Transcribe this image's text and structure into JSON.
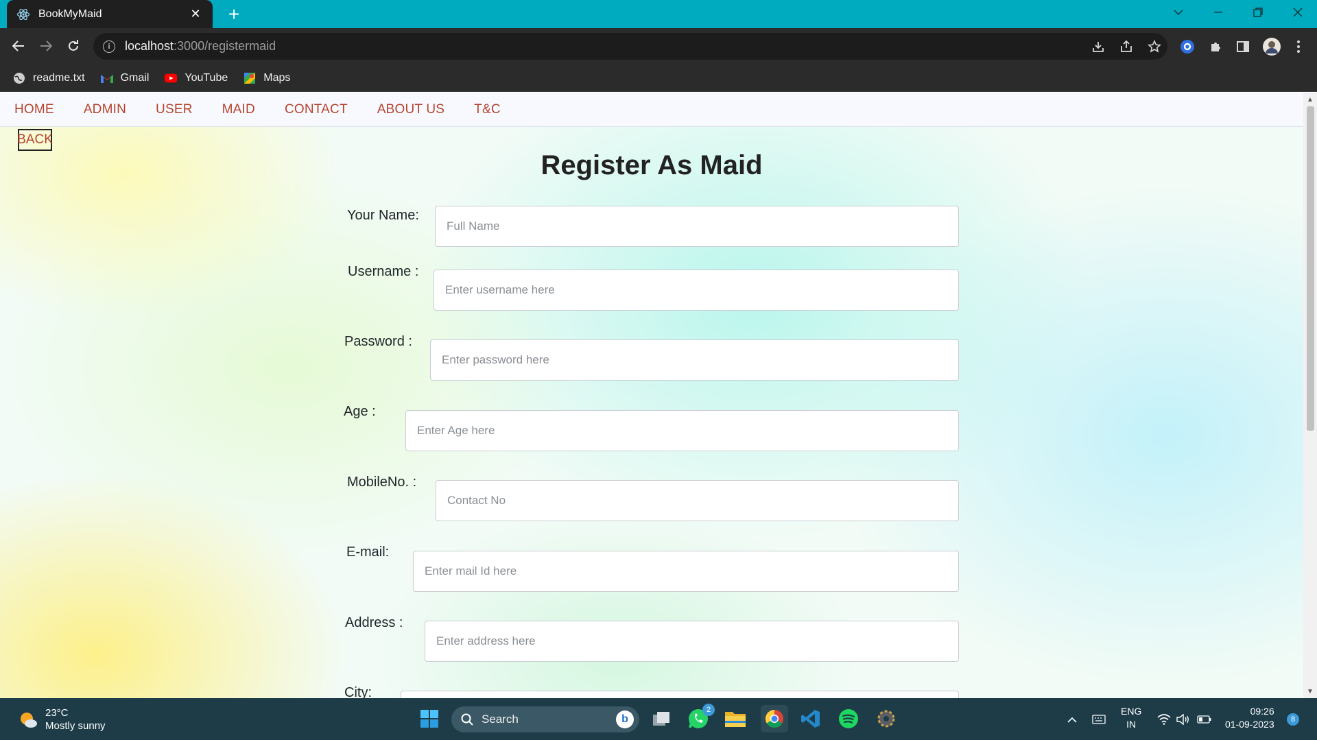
{
  "browser": {
    "tab_title": "BookMyMaid",
    "url_host": "localhost",
    "url_path": ":3000/registermaid",
    "bookmarks": [
      {
        "label": "readme.txt",
        "icon": "globe-icon"
      },
      {
        "label": "Gmail",
        "icon": "gmail-icon"
      },
      {
        "label": "YouTube",
        "icon": "youtube-icon"
      },
      {
        "label": "Maps",
        "icon": "maps-icon"
      }
    ]
  },
  "nav": {
    "links": [
      "HOME",
      "ADMIN",
      "USER",
      "MAID",
      "CONTACT",
      "ABOUT US",
      "T&C"
    ]
  },
  "page": {
    "back_label": "BACK",
    "title": "Register As Maid"
  },
  "form": {
    "fields": [
      {
        "label": "Your Name:",
        "placeholder": "Full Name"
      },
      {
        "label": "Username :",
        "placeholder": "Enter username here"
      },
      {
        "label": "Password :",
        "placeholder": "Enter password here"
      },
      {
        "label": "Age :",
        "placeholder": "Enter Age here"
      },
      {
        "label": "MobileNo. :",
        "placeholder": "Contact No"
      },
      {
        "label": "E-mail:",
        "placeholder": "Enter mail Id here"
      },
      {
        "label": "Address :",
        "placeholder": "Enter address here"
      },
      {
        "label": "City:",
        "placeholder": ""
      }
    ]
  },
  "taskbar": {
    "weather_temp": "23°C",
    "weather_cond": "Mostly sunny",
    "search_label": "Search",
    "whatsapp_badge": "2",
    "lang_top": "ENG",
    "lang_bottom": "IN",
    "time": "09:26",
    "date": "01-09-2023",
    "notification_count": "8"
  },
  "colors": {
    "tabbar": "#00abbf",
    "nav_link": "#b4442c",
    "taskbar": "#1d3c48"
  }
}
